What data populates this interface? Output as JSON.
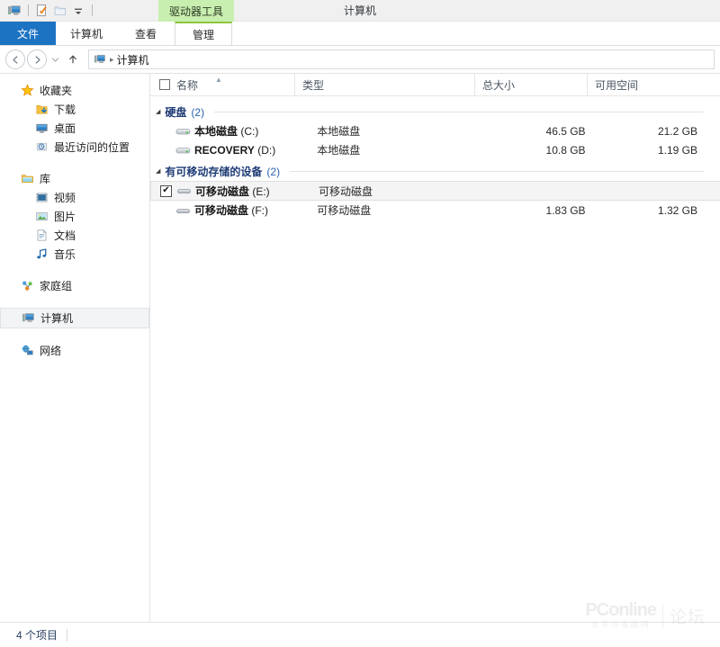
{
  "window": {
    "title": "计算机",
    "contextual_tab_header": "驱动器工具"
  },
  "quick_access_toolbar": {
    "icons": [
      "computer-icon",
      "properties-icon",
      "new-folder-icon",
      "customize-dropdown-icon"
    ]
  },
  "ribbon": {
    "tabs": [
      {
        "label": "文件",
        "active": true,
        "accent": "#1c73c2"
      },
      {
        "label": "计算机",
        "active": false
      },
      {
        "label": "查看",
        "active": false
      },
      {
        "label": "管理",
        "active": false,
        "contextual": true,
        "accent": "#8dc63f"
      }
    ]
  },
  "address_bar": {
    "back_icon": "back-arrow-icon",
    "forward_icon": "forward-arrow-icon",
    "history_icon": "chevron-down-icon",
    "up_icon": "up-arrow-icon",
    "location_icon": "computer-icon",
    "separator": "▸",
    "path": "计算机"
  },
  "sidebar": {
    "groups": [
      {
        "root": {
          "label": "收藏夹",
          "icon": "star-icon"
        },
        "items": [
          {
            "label": "下载",
            "icon": "downloads-icon"
          },
          {
            "label": "桌面",
            "icon": "desktop-icon"
          },
          {
            "label": "最近访问的位置",
            "icon": "recent-places-icon"
          }
        ]
      },
      {
        "root": {
          "label": "库",
          "icon": "libraries-icon"
        },
        "items": [
          {
            "label": "视频",
            "icon": "videos-icon"
          },
          {
            "label": "图片",
            "icon": "pictures-icon"
          },
          {
            "label": "文档",
            "icon": "documents-icon"
          },
          {
            "label": "音乐",
            "icon": "music-icon"
          }
        ]
      },
      {
        "root": {
          "label": "家庭组",
          "icon": "homegroup-icon"
        },
        "items": []
      },
      {
        "root": {
          "label": "计算机",
          "icon": "computer-icon",
          "selected": true
        },
        "items": []
      },
      {
        "root": {
          "label": "网络",
          "icon": "network-icon"
        },
        "items": []
      }
    ]
  },
  "file_list": {
    "columns": [
      {
        "label": "名称",
        "sort": "asc"
      },
      {
        "label": "类型"
      },
      {
        "label": "总大小"
      },
      {
        "label": "可用空间"
      }
    ],
    "groups": [
      {
        "name": "硬盘",
        "count": "(2)",
        "rows": [
          {
            "icon": "hard-drive-icon",
            "name": "本地磁盘",
            "letter": " (C:)",
            "type": "本地磁盘",
            "size": "46.5 GB",
            "free": "21.2 GB",
            "checked": false,
            "selected": false
          },
          {
            "icon": "hard-drive-icon",
            "name": "RECOVERY",
            "letter": " (D:)",
            "type": "本地磁盘",
            "size": "10.8 GB",
            "free": "1.19 GB",
            "checked": false,
            "selected": false
          }
        ]
      },
      {
        "name": "有可移动存储的设备",
        "count": "(2)",
        "rows": [
          {
            "icon": "removable-drive-icon",
            "name": "可移动磁盘",
            "letter": " (E:)",
            "type": "可移动磁盘",
            "size": "",
            "free": "",
            "checked": true,
            "selected": true
          },
          {
            "icon": "removable-drive-icon",
            "name": "可移动磁盘",
            "letter": " (F:)",
            "type": "可移动磁盘",
            "size": "1.83 GB",
            "free": "1.32 GB",
            "checked": false,
            "selected": false
          }
        ]
      }
    ]
  },
  "status_bar": {
    "item_count": "4 个项目"
  },
  "watermark": {
    "main": "PConline",
    "sub": "太平洋电脑网",
    "forum": "论坛"
  }
}
